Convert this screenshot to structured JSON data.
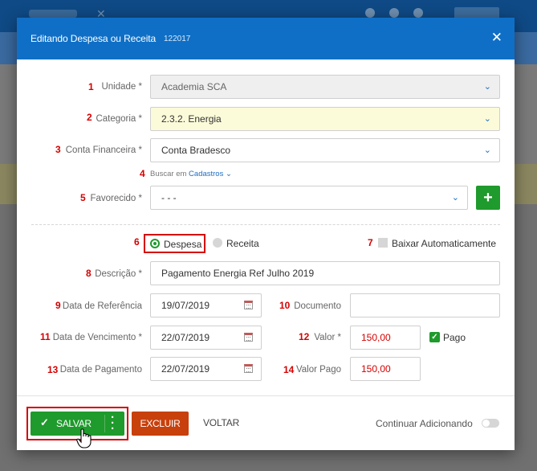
{
  "modal": {
    "title": "Editando Despesa ou Receita",
    "record_id": "122017",
    "close_symbol": "✕"
  },
  "form": {
    "unidade": {
      "num": "1",
      "label": "Unidade *",
      "value": "Academia SCA"
    },
    "categoria": {
      "num": "2",
      "label": "Categoria *",
      "value": "2.3.2. Energia"
    },
    "conta": {
      "num": "3",
      "label": "Conta Financeira *",
      "value": "Conta Bradesco"
    },
    "buscar": {
      "num": "4",
      "prefix": "Buscar em",
      "link": "Cadastros"
    },
    "favorecido": {
      "num": "5",
      "label": "Favorecido *",
      "value": "- - -"
    },
    "tipo": {
      "num": "6",
      "despesa": "Despesa",
      "receita": "Receita",
      "selected": "Despesa"
    },
    "baixar": {
      "num": "7",
      "label": "Baixar Automaticamente",
      "checked": false
    },
    "descricao": {
      "num": "8",
      "label": "Descrição *",
      "value": "Pagamento Energia Ref Julho 2019"
    },
    "data_referencia": {
      "num": "9",
      "label": "Data de Referência",
      "value": "19/07/2019"
    },
    "documento": {
      "num": "10",
      "label": "Documento",
      "value": ""
    },
    "data_vencimento": {
      "num": "11",
      "label": "Data de Vencimento *",
      "value": "22/07/2019"
    },
    "valor": {
      "num": "12",
      "label": "Valor *",
      "value": "150,00"
    },
    "pago": {
      "label": "Pago",
      "checked": true
    },
    "data_pagamento": {
      "num": "13",
      "label": "Data de Pagamento",
      "value": "22/07/2019"
    },
    "valor_pago": {
      "num": "14",
      "label": "Valor Pago",
      "value": "150,00"
    }
  },
  "footer": {
    "save_label": "SALVAR",
    "delete_label": "EXCLUIR",
    "back_label": "VOLTAR",
    "continue_label": "Continuar Adicionando",
    "continue_on": false
  },
  "colors": {
    "header": "#0f6fc6",
    "save": "#1f9a2c",
    "delete": "#c8400c",
    "annotation": "#d40000"
  }
}
